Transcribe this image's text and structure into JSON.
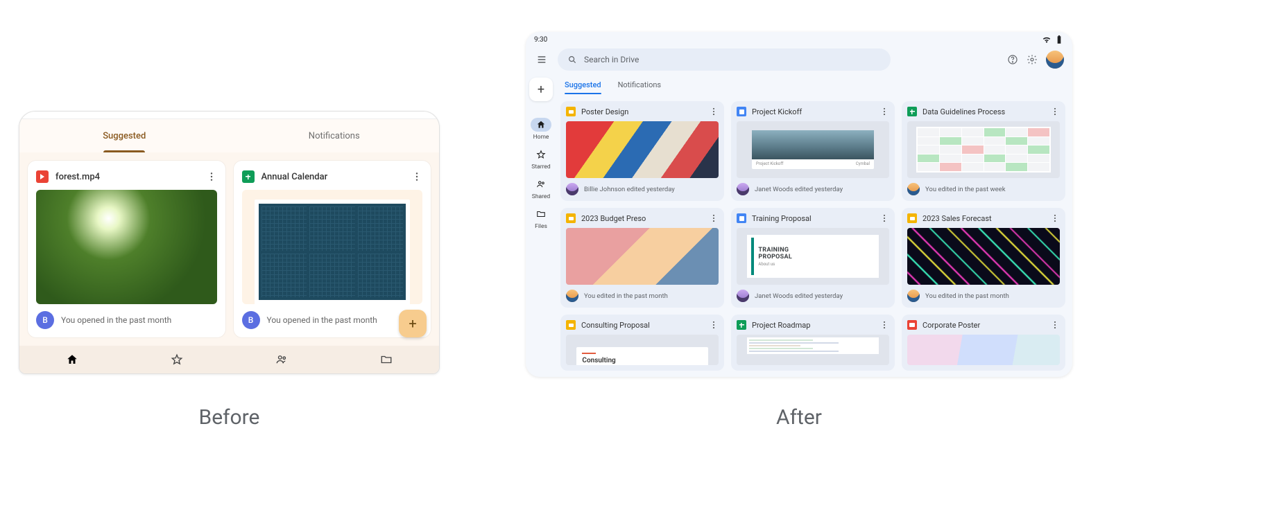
{
  "labels": {
    "before": "Before",
    "after": "After"
  },
  "before": {
    "tabs": {
      "suggested": "Suggested",
      "notifications": "Notifications",
      "active": "suggested"
    },
    "cards": [
      {
        "title": "forest.mp4",
        "type": "video",
        "avatar": "B",
        "footer": "You opened in the past month"
      },
      {
        "title": "Annual Calendar",
        "type": "sheets",
        "avatar": "B",
        "footer": "You opened in the past month"
      }
    ],
    "nav": [
      {
        "id": "home",
        "active": true
      },
      {
        "id": "starred",
        "active": false
      },
      {
        "id": "shared",
        "active": false
      },
      {
        "id": "files",
        "active": false
      }
    ],
    "fab": "+"
  },
  "after": {
    "status": {
      "time": "9:30"
    },
    "search": {
      "placeholder": "Search in Drive"
    },
    "tabs": {
      "suggested": "Suggested",
      "notifications": "Notifications",
      "active": "suggested"
    },
    "rail": {
      "add": "+",
      "items": [
        {
          "id": "home",
          "label": "Home",
          "active": true
        },
        {
          "id": "starred",
          "label": "Starred",
          "active": false
        },
        {
          "id": "shared",
          "label": "Shared",
          "active": false
        },
        {
          "id": "files",
          "label": "Files",
          "active": false
        }
      ]
    },
    "cards": [
      {
        "title": "Poster Design",
        "type": "slides",
        "footer": "Billie Johnson edited yesterday",
        "avatar": "alt",
        "thumb": "poster"
      },
      {
        "title": "Project Kickoff",
        "type": "docs",
        "footer": "Janet Woods edited yesterday",
        "avatar": "alt",
        "thumb": "kickoff",
        "thumbText1": "Project Kickoff",
        "thumbText2": "Cymbal"
      },
      {
        "title": "Data Guidelines Process",
        "type": "sheets",
        "footer": "You edited in the past week",
        "avatar": "self",
        "thumb": "guidelines"
      },
      {
        "title": "2023 Budget Preso",
        "type": "slides",
        "footer": "You edited in the past month",
        "avatar": "self",
        "thumb": "budget"
      },
      {
        "title": "Training Proposal",
        "type": "docs",
        "footer": "Janet Woods edited yesterday",
        "avatar": "alt",
        "thumb": "training",
        "thumbText1": "TRAINING",
        "thumbText2": "PROPOSAL",
        "thumbText3": "About us"
      },
      {
        "title": "2023 Sales Forecast",
        "type": "slides",
        "footer": "You edited in the past month",
        "avatar": "self",
        "thumb": "sales"
      },
      {
        "title": "Consulting Proposal",
        "type": "slides",
        "footer": "",
        "avatar": "",
        "thumb": "consult",
        "thumbText1": "Consulting"
      },
      {
        "title": "Project Roadmap",
        "type": "sheets",
        "footer": "",
        "avatar": "",
        "thumb": "roadmap"
      },
      {
        "title": "Corporate Poster",
        "type": "img",
        "footer": "",
        "avatar": "",
        "thumb": "corp"
      }
    ]
  }
}
